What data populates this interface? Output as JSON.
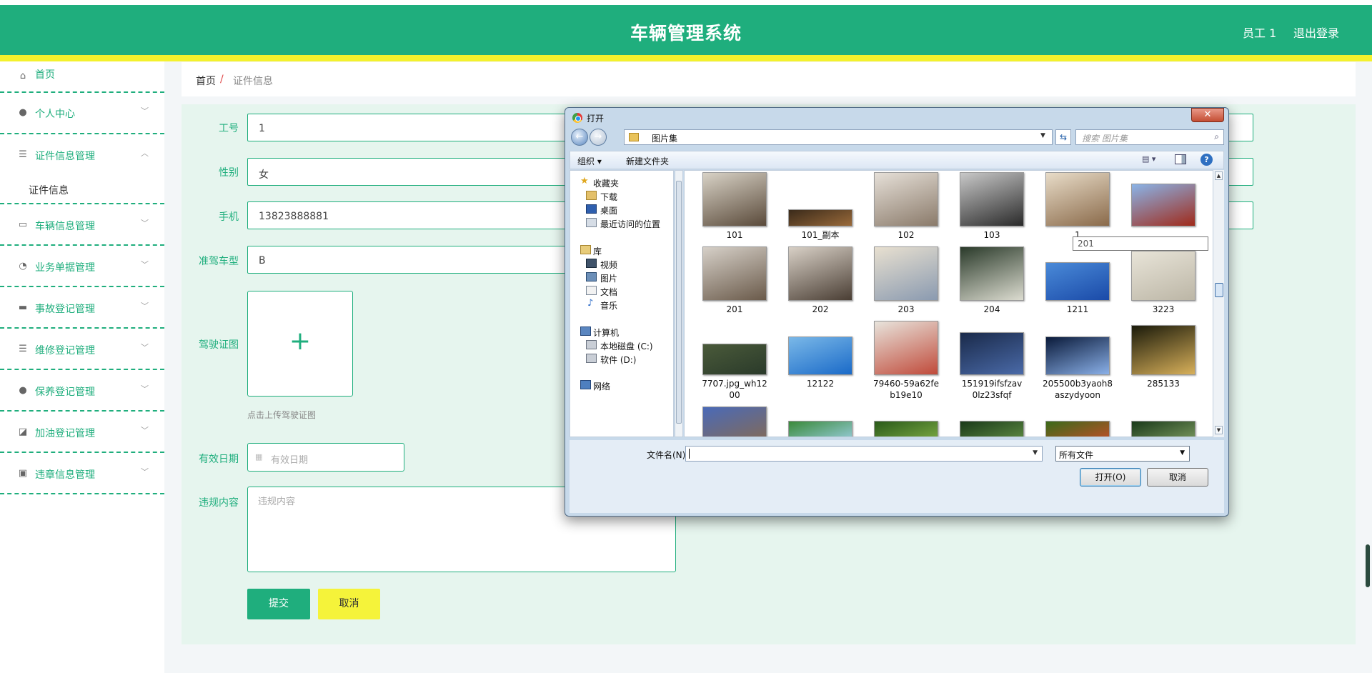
{
  "header": {
    "title": "车辆管理系统",
    "user": "员工 1",
    "logout": "退出登录"
  },
  "sidebar": {
    "items": [
      {
        "label": "首页",
        "icon": "home-icon",
        "expandable": false
      },
      {
        "label": "个人中心",
        "icon": "user-icon",
        "expandable": true
      },
      {
        "label": "证件信息管理",
        "icon": "menu-icon",
        "expandable": true,
        "expanded": true,
        "children": [
          "证件信息"
        ]
      },
      {
        "label": "车辆信息管理",
        "icon": "chat-icon",
        "expandable": true
      },
      {
        "label": "业务单据管理",
        "icon": "gauge-icon",
        "expandable": true
      },
      {
        "label": "事故登记管理",
        "icon": "message-icon",
        "expandable": true
      },
      {
        "label": "维修登记管理",
        "icon": "list-icon",
        "expandable": true
      },
      {
        "label": "保养登记管理",
        "icon": "user-icon",
        "expandable": true
      },
      {
        "label": "加油登记管理",
        "icon": "chart-icon",
        "expandable": true
      },
      {
        "label": "违章信息管理",
        "icon": "clipboard-icon",
        "expandable": true
      }
    ]
  },
  "breadcrumb": {
    "home": "首页",
    "separator": "/",
    "current": "证件信息"
  },
  "form": {
    "job_no": {
      "label": "工号",
      "value": "1"
    },
    "gender": {
      "label": "性别",
      "value": "女"
    },
    "phone": {
      "label": "手机",
      "value": "13823888881"
    },
    "license_type": {
      "label": "准驾车型",
      "value": "B"
    },
    "license_image": {
      "label": "驾驶证图",
      "hint": "点击上传驾驶证图",
      "plus": "+"
    },
    "valid_date": {
      "label": "有效日期",
      "placeholder": "有效日期"
    },
    "violation": {
      "label": "违规内容",
      "placeholder": "违规内容"
    },
    "submit": "提交",
    "cancel": "取消"
  },
  "dialog": {
    "title": "打开",
    "close": "✕",
    "path": "图片集",
    "search_placeholder": "搜索 图片集",
    "organize": "组织 ▾",
    "new_folder": "新建文件夹",
    "nav": {
      "favorites": "收藏夹",
      "downloads": "下载",
      "desktop": "桌面",
      "recent": "最近访问的位置",
      "libraries": "库",
      "videos": "视频",
      "pictures": "图片",
      "documents": "文档",
      "music": "音乐",
      "computer": "计算机",
      "drive_c": "本地磁盘 (C:)",
      "drive_d": "软件 (D:)",
      "network": "网络"
    },
    "tooltip": "201",
    "files": [
      {
        "name": "101",
        "colors": [
          "#d8d2c6",
          "#5a4a3a"
        ]
      },
      {
        "name": "101_副本",
        "colors": [
          "#3a2a1a",
          "#9a6a3a"
        ]
      },
      {
        "name": "102",
        "colors": [
          "#e6e0d8",
          "#8a7a6a"
        ]
      },
      {
        "name": "103",
        "colors": [
          "#c8c8c8",
          "#2a2a2a"
        ]
      },
      {
        "name": "1",
        "colors": [
          "#e8dcc8",
          "#8a6a4a"
        ]
      },
      {
        "name": "",
        "colors": [
          "#8ab4e8",
          "#a02a1a"
        ]
      },
      {
        "name": "201",
        "colors": [
          "#d6d0c8",
          "#6a5a4a"
        ]
      },
      {
        "name": "202",
        "colors": [
          "#d8d0c6",
          "#4a3e34"
        ]
      },
      {
        "name": "203",
        "colors": [
          "#e8e0d0",
          "#8a9ab0"
        ]
      },
      {
        "name": "204",
        "colors": [
          "#2a3a2a",
          "#dcdcd0"
        ]
      },
      {
        "name": "1211",
        "colors": [
          "#4a8ad8",
          "#1a4aa8"
        ]
      },
      {
        "name": "3223",
        "colors": [
          "#e8e4d8",
          "#bcb6a6"
        ]
      },
      {
        "name": "7707.jpg_wh1200",
        "colors": [
          "#4a5a3a",
          "#2a3a2a"
        ]
      },
      {
        "name": "12122",
        "colors": [
          "#7ab8e8",
          "#1a6ac8"
        ]
      },
      {
        "name": "79460-59a62feb19e10",
        "colors": [
          "#e8e4dc",
          "#c04a3a"
        ]
      },
      {
        "name": "151919ifsfzav0lz23sfqf",
        "colors": [
          "#1a2a4a",
          "#4a6aa8"
        ]
      },
      {
        "name": "205500b3yaoh8aszydyoon",
        "colors": [
          "#0a1a3a",
          "#8ab0e8"
        ]
      },
      {
        "name": "285133",
        "colors": [
          "#1a1a0a",
          "#d8b05a"
        ]
      },
      {
        "name": "",
        "colors": [
          "#4a6ab8",
          "#8a6a4a"
        ]
      },
      {
        "name": "",
        "colors": [
          "#3a8a3a",
          "#a8d8f8"
        ]
      },
      {
        "name": "",
        "colors": [
          "#2a5a1a",
          "#8ab84a"
        ]
      },
      {
        "name": "",
        "colors": [
          "#1a3a1a",
          "#6a9a4a"
        ]
      },
      {
        "name": "",
        "colors": [
          "#3a6a1a",
          "#d84a2a"
        ]
      },
      {
        "name": "",
        "colors": [
          "#1a3a1a",
          "#8aa86a"
        ]
      }
    ],
    "file_name_label": "文件名(N):",
    "file_type": "所有文件",
    "open": "打开(O)",
    "cancel": "取消"
  },
  "colors": {
    "primary": "#1fae7d",
    "accent_yellow": "#f4f12d",
    "panel_bg": "#e6f5ee"
  }
}
